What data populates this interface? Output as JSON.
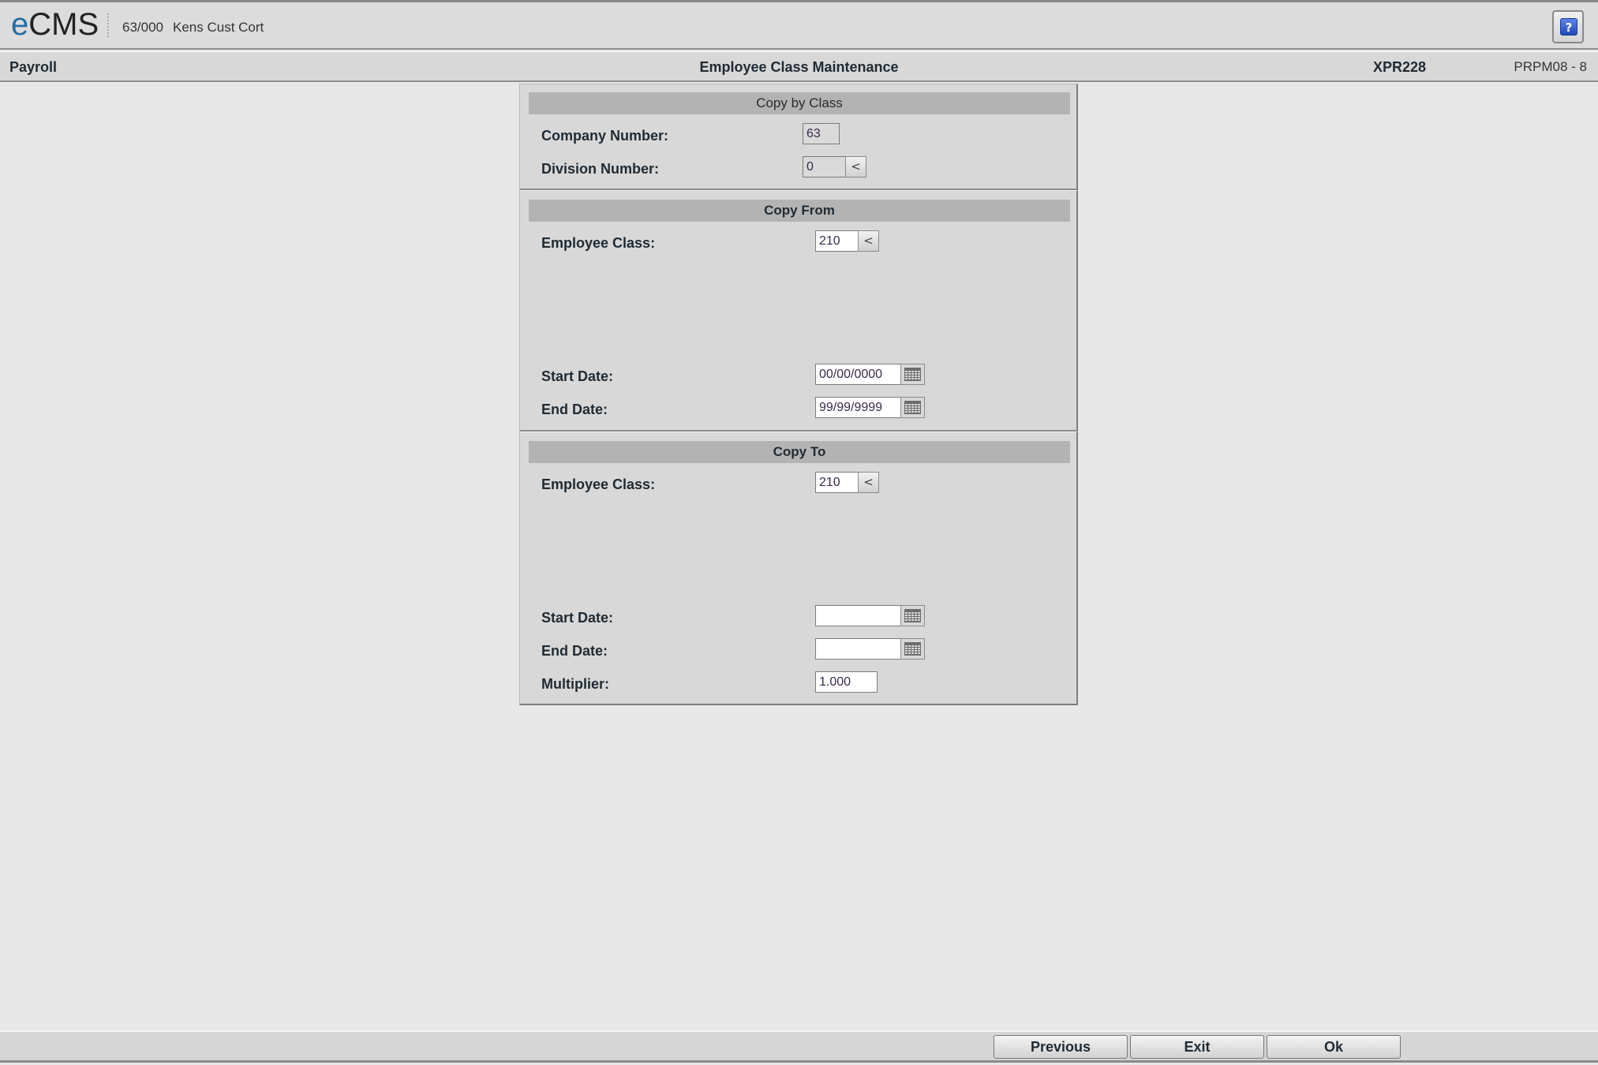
{
  "app": {
    "logo_prefix": "e",
    "logo_suffix": "CMS",
    "company_code": "63/000",
    "company_name": "Kens Cust Cort",
    "help_label": "?"
  },
  "header": {
    "module": "Payroll",
    "title": "Employee Class Maintenance",
    "program": "XPR228",
    "screen_id": "PRPM08 - 8"
  },
  "form": {
    "copy_by_class": {
      "heading": "Copy by Class",
      "company_number": {
        "label": "Company Number:",
        "value": "63"
      },
      "division_number": {
        "label": "Division Number:",
        "value": "0"
      }
    },
    "copy_from": {
      "heading": "Copy From",
      "employee_class": {
        "label": "Employee Class:",
        "value": "210"
      },
      "start_date": {
        "label": "Start Date:",
        "value": "00/00/0000"
      },
      "end_date": {
        "label": "End Date:",
        "value": "99/99/9999"
      }
    },
    "copy_to": {
      "heading": "Copy To",
      "employee_class": {
        "label": "Employee Class:",
        "value": "210"
      },
      "start_date": {
        "label": "Start Date:",
        "value": ""
      },
      "end_date": {
        "label": "End Date:",
        "value": ""
      },
      "multiplier": {
        "label": "Multiplier:",
        "value": "1.000"
      }
    },
    "lookup_glyph": "<"
  },
  "footer": {
    "previous_label": "Previous",
    "exit_label": "Exit",
    "ok_label": "Ok"
  }
}
